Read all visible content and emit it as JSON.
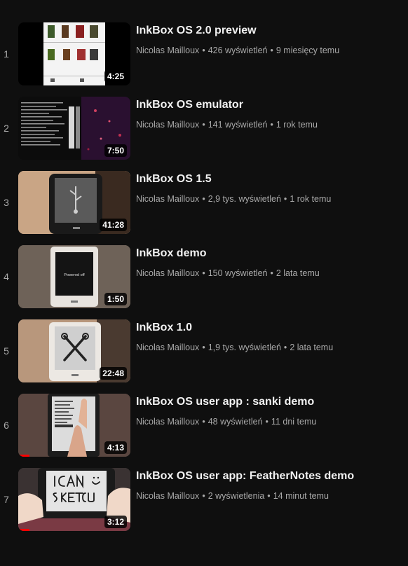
{
  "playlist": {
    "items": [
      {
        "index": "1",
        "title": "InkBox OS 2.0 preview",
        "channel": "Nicolas Mailloux",
        "views": "426 wyświetleń",
        "age": "9 miesięcy temu",
        "duration": "4:25",
        "progress": 0,
        "thumb": "ui-screenshot"
      },
      {
        "index": "2",
        "title": "InkBox OS emulator",
        "channel": "Nicolas Mailloux",
        "views": "141 wyświetleń",
        "age": "1 rok temu",
        "duration": "7:50",
        "progress": 0,
        "thumb": "terminal"
      },
      {
        "index": "3",
        "title": "InkBox OS 1.5",
        "channel": "Nicolas Mailloux",
        "views": "2,9 tys. wyświetleń",
        "age": "1 rok temu",
        "duration": "41:28",
        "progress": 0,
        "thumb": "usb-reader"
      },
      {
        "index": "4",
        "title": "InkBox demo",
        "channel": "Nicolas Mailloux",
        "views": "150 wyświetleń",
        "age": "2 lata temu",
        "duration": "1:50",
        "progress": 0,
        "thumb": "powered-off-reader"
      },
      {
        "index": "5",
        "title": "InkBox 1.0",
        "channel": "Nicolas Mailloux",
        "views": "1,9 tys. wyświetleń",
        "age": "2 lata temu",
        "duration": "22:48",
        "progress": 0,
        "thumb": "tools-reader"
      },
      {
        "index": "6",
        "title": "InkBox OS user app : sanki demo",
        "channel": "Nicolas Mailloux",
        "views": "48 wyświetleń",
        "age": "11 dni temu",
        "duration": "4:13",
        "progress": 0.1,
        "thumb": "hand-reader"
      },
      {
        "index": "7",
        "title": "InkBox OS user app: FeatherNotes demo",
        "channel": "Nicolas Mailloux",
        "views": "2 wyświetlenia",
        "age": "14 minut temu",
        "duration": "3:12",
        "progress": 0.1,
        "thumb": "handwriting"
      }
    ]
  },
  "thumb_texts": {
    "powered_off": "Powered off"
  },
  "colors": {
    "background": "#0f0f0f",
    "progress": "#ff0000",
    "meta_text": "#aaaaaa"
  }
}
